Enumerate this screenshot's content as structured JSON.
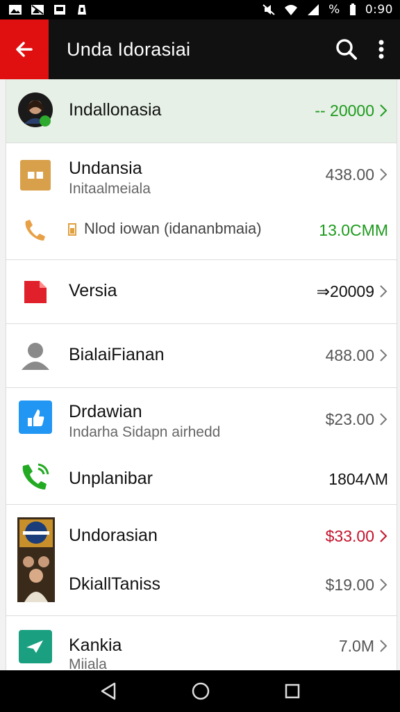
{
  "status_bar": {
    "icons_left": [
      "gallery-icon",
      "no-image-icon",
      "image-icon",
      "notification-icon"
    ],
    "battery": "%",
    "time": "0:90"
  },
  "app_bar": {
    "title": "Unda Idorasiai",
    "back_icon": "arrow-left-icon",
    "search_icon": "search-icon",
    "more_icon": "more-vert-icon",
    "accent_color": "#e01010"
  },
  "items": [
    {
      "title": "Indallonasia",
      "amount": "-- 20000",
      "amount_color": "#1d9a1d"
    },
    {
      "title": "Undansia",
      "subtitle": "Initaalmeiala",
      "amount": "438.00",
      "amount_color": "#555555"
    },
    {
      "title": "Nlod iowan (idananbmaia)",
      "amount": "13.0CMM",
      "amount_color": "#1d9a1d"
    },
    {
      "title": "Versia",
      "amount": "⇒20009",
      "amount_color": "#111111"
    },
    {
      "title": "BialaiFianan",
      "amount": "488.00",
      "amount_color": "#555555"
    },
    {
      "title": "Drdawian",
      "subtitle": "Indarha Sidapn airhedd",
      "amount": "$23.00",
      "amount_color": "#555555"
    },
    {
      "title": "Unplanibar",
      "amount": "1804ΛM",
      "amount_color": "#111111"
    },
    {
      "title": "Undorasian",
      "amount": "$33.00",
      "amount_color": "#c4122a"
    },
    {
      "title": "DkiallTaniss",
      "amount": "$19.00",
      "amount_color": "#555555"
    },
    {
      "title": "Kankia",
      "subtitle": "Miiala",
      "amount": "7.0M",
      "amount_color": "#555555"
    }
  ],
  "nav_bar": {
    "back_icon": "nav-back-icon",
    "home_icon": "nav-home-icon",
    "recents_icon": "nav-recents-icon"
  }
}
